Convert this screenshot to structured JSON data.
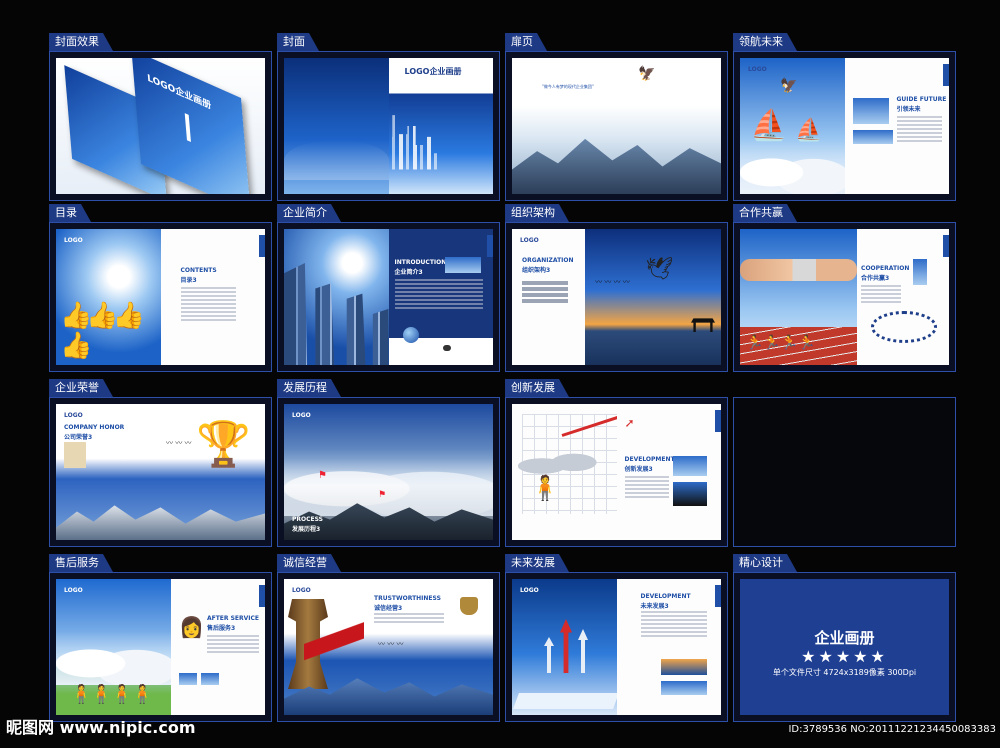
{
  "panels": [
    {
      "id": "cover-effect",
      "label": "封面效果",
      "logo_text": "LOGO企业画册"
    },
    {
      "id": "cover",
      "label": "封面",
      "logo_text": "LOGO企业画册"
    },
    {
      "id": "title-page",
      "label": "扉页",
      "quote": "\"做今人有梦的现代企业集团\""
    },
    {
      "id": "lead-future",
      "label": "领航未来",
      "heading": "GUIDE FUTURE",
      "sub": "引领未来"
    },
    {
      "id": "contents",
      "label": "目录",
      "heading": "CONTENTS",
      "sub": "目录3"
    },
    {
      "id": "company-intro",
      "label": "企业简介",
      "heading": "INTRODUCTION",
      "sub": "企业简介3"
    },
    {
      "id": "organization",
      "label": "组织架构",
      "heading": "ORGANIZATION",
      "sub": "组织架构3"
    },
    {
      "id": "cooperation",
      "label": "合作共赢",
      "heading": "COOPERATION",
      "sub": "合作共赢3"
    },
    {
      "id": "honor",
      "label": "企业荣誉",
      "heading": "COMPANY HONOR",
      "sub": "公司荣誉3"
    },
    {
      "id": "history",
      "label": "发展历程",
      "heading": "PROCESS",
      "sub": "发展历程3"
    },
    {
      "id": "innovation",
      "label": "创新发展",
      "heading": "DEVELOPMENT",
      "sub": "创新发展3"
    },
    {
      "id": "empty",
      "label": ""
    },
    {
      "id": "after-service",
      "label": "售后服务",
      "heading": "AFTER SERVICE",
      "sub": "售后服务3"
    },
    {
      "id": "integrity",
      "label": "诚信经营",
      "heading": "TRUSTWORTHINESS",
      "sub": "诚信经营3"
    },
    {
      "id": "future-dev",
      "label": "未来发展",
      "heading": "DEVELOPMENT",
      "sub": "未来发展3"
    },
    {
      "id": "fine-design",
      "label": "精心设计",
      "title": "企业画册",
      "stars": "★★★★★",
      "detail": "单个文件尺寸 4724x3189像素 300Dpi"
    }
  ],
  "footer": {
    "watermark": "昵图网 www.nipic.com",
    "id_text": "ID:3789536 NO:20111221234450083383"
  },
  "logo_small": "LOGO"
}
